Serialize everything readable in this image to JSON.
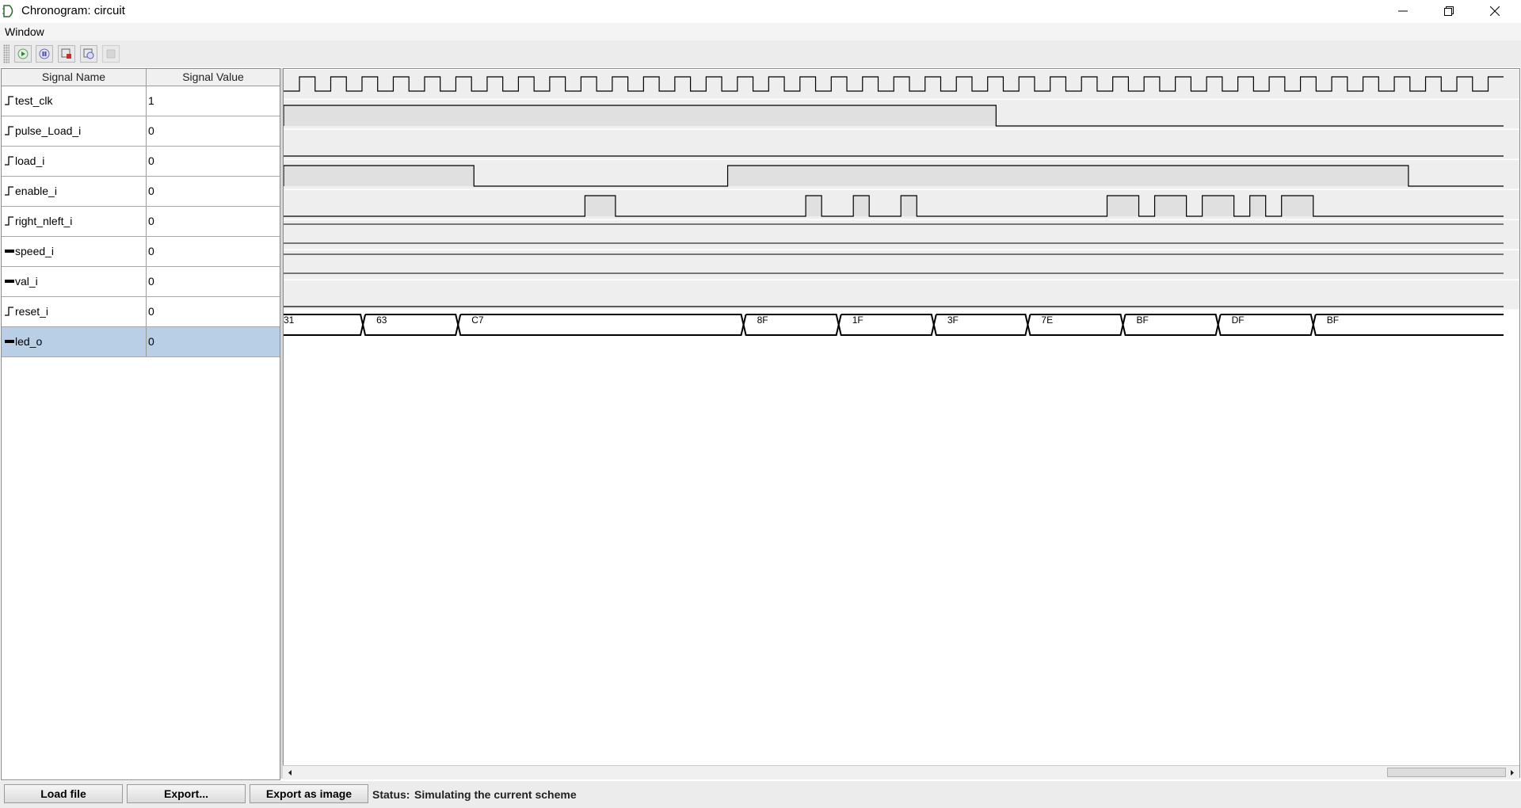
{
  "window": {
    "title": "Chronogram: circuit",
    "controls": [
      "minimize-icon",
      "restore-icon",
      "close-icon"
    ]
  },
  "menu": {
    "window_label": "Window"
  },
  "toolbar": {
    "buttons": [
      "play-icon",
      "pause-icon",
      "step-icon",
      "reset-icon",
      "stop-icon"
    ]
  },
  "table": {
    "header_name": "Signal Name",
    "header_value": "Signal Value",
    "rows": [
      {
        "name": "test_clk",
        "value": "1",
        "type": "bit"
      },
      {
        "name": "pulse_Load_i",
        "value": "0",
        "type": "bit"
      },
      {
        "name": "load_i",
        "value": "0",
        "type": "bit"
      },
      {
        "name": "enable_i",
        "value": "0",
        "type": "bit"
      },
      {
        "name": "right_nleft_i",
        "value": "0",
        "type": "bit"
      },
      {
        "name": "speed_i",
        "value": "0",
        "type": "bus"
      },
      {
        "name": "val_i",
        "value": "0",
        "type": "bus"
      },
      {
        "name": "reset_i",
        "value": "0",
        "type": "bit"
      },
      {
        "name": "led_o",
        "value": "0",
        "type": "bus",
        "selected": true
      }
    ]
  },
  "waveforms": {
    "clock_half_periods": 78,
    "pulse_Load_i": [
      [
        0,
        0.584,
        1
      ]
    ],
    "enable_i": [
      [
        0,
        0.156,
        1
      ],
      [
        0.364,
        0.922,
        1
      ]
    ],
    "right_nleft_i": [
      [
        0.247,
        0.272,
        1
      ],
      [
        0.428,
        0.441,
        1
      ],
      [
        0.467,
        0.48,
        1
      ],
      [
        0.506,
        0.519,
        1
      ],
      [
        0.675,
        0.701,
        1
      ],
      [
        0.714,
        0.74,
        1
      ],
      [
        0.753,
        0.779,
        1
      ],
      [
        0.792,
        0.805,
        1
      ],
      [
        0.818,
        0.844,
        1
      ]
    ],
    "led_o": [
      {
        "start": 0,
        "end": 0.065,
        "label": "31"
      },
      {
        "start": 0.065,
        "end": 0.143,
        "label": "63"
      },
      {
        "start": 0.143,
        "end": 0.377,
        "label": "C7"
      },
      {
        "start": 0.377,
        "end": 0.455,
        "label": "8F"
      },
      {
        "start": 0.455,
        "end": 0.533,
        "label": "1F"
      },
      {
        "start": 0.533,
        "end": 0.61,
        "label": "3F"
      },
      {
        "start": 0.61,
        "end": 0.688,
        "label": "7E"
      },
      {
        "start": 0.688,
        "end": 0.766,
        "label": "BF"
      },
      {
        "start": 0.766,
        "end": 0.844,
        "label": "DF"
      },
      {
        "start": 0.844,
        "end": 1.0,
        "label": "BF"
      }
    ]
  },
  "colors": {
    "selection": "#b8cfe5",
    "wave_fill": "#e0e0e0",
    "wave_row_bg": "#eeeeee"
  },
  "bottom": {
    "load_button": "Load file",
    "export_button": "Export...",
    "export_image_button": "Export as image",
    "status_label": "Status:",
    "status_text": "Simulating the current scheme"
  }
}
